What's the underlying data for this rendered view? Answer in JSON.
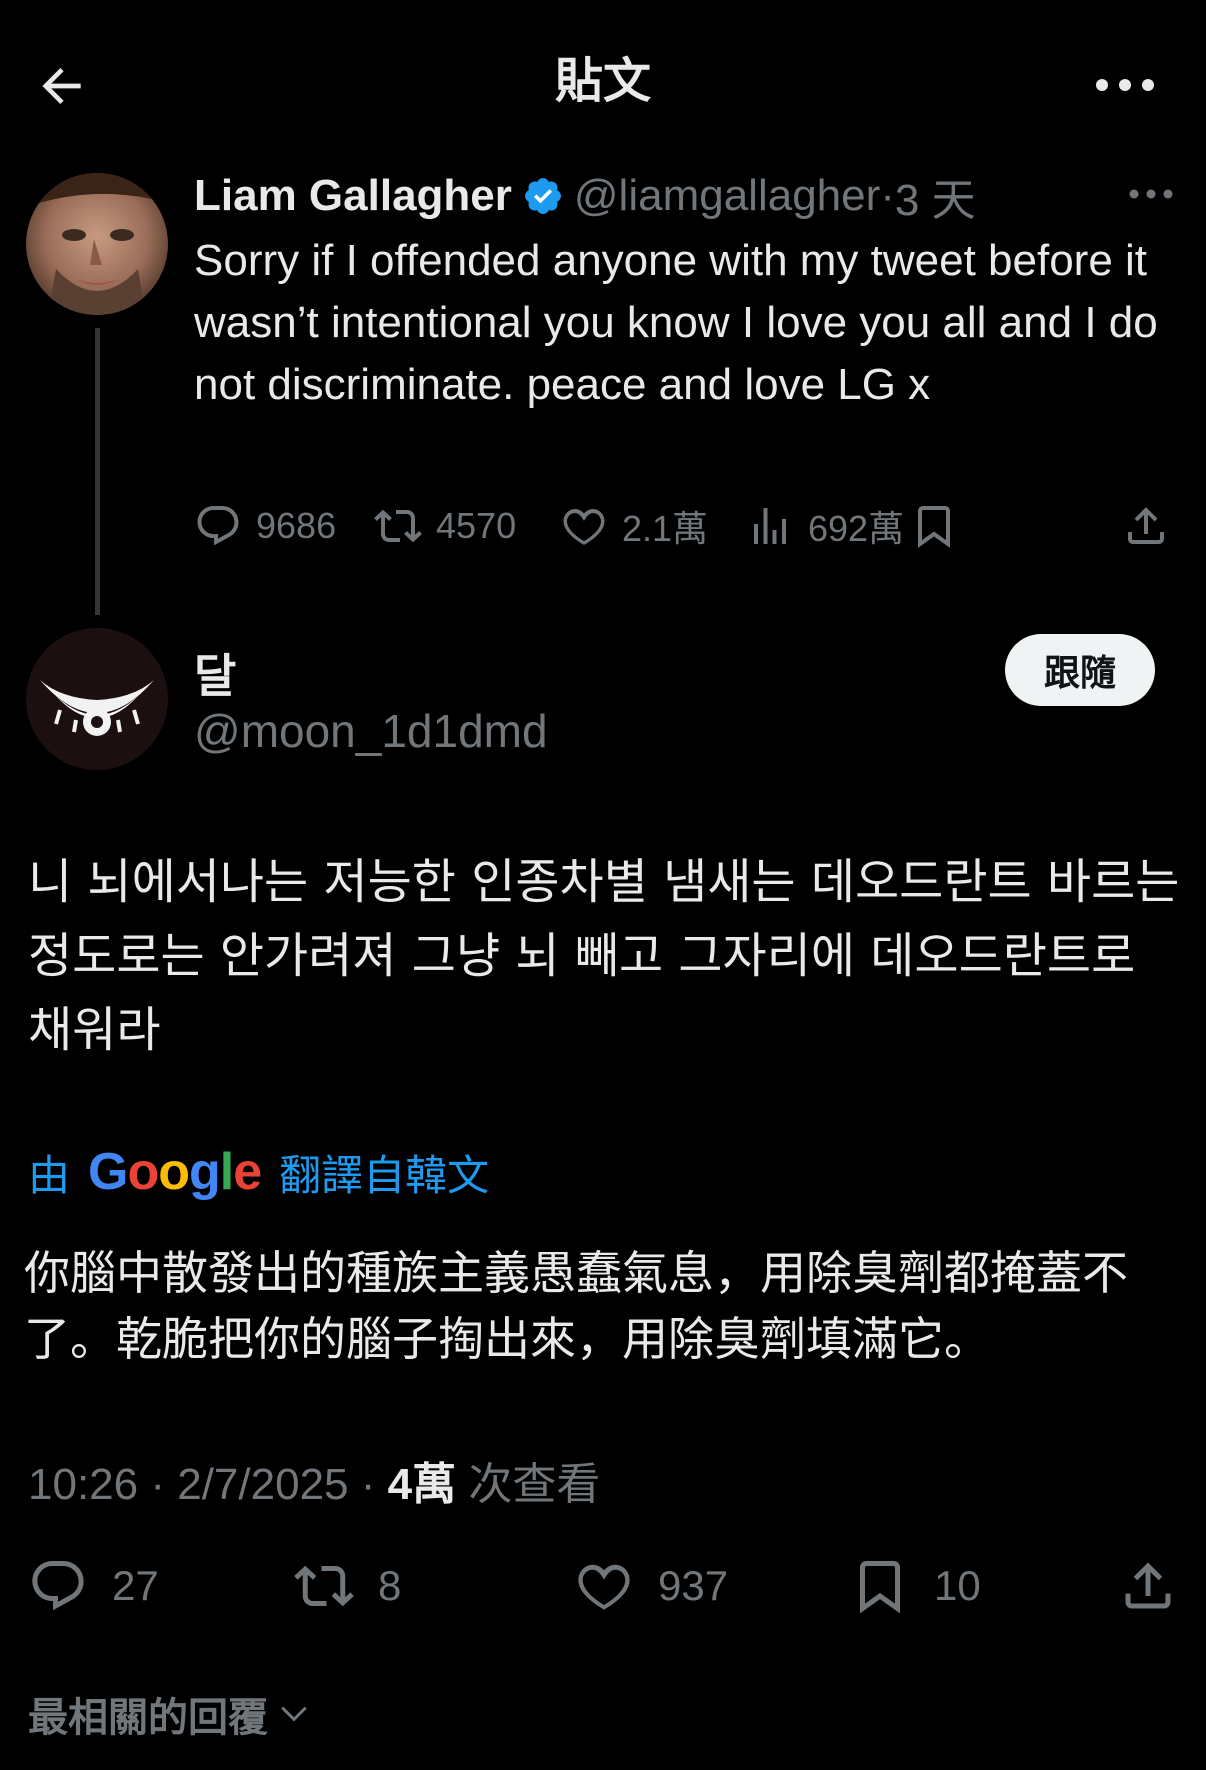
{
  "header": {
    "title": "貼文"
  },
  "parent_tweet": {
    "name": "Liam Gallagher",
    "handle": "@liamgallagher",
    "separator": " · ",
    "time": "3 天",
    "body": "Sorry if I offended anyone with my tweet before it wasn’t intentional you know I love you all and I do not discriminate. peace and love LG x",
    "replies": "9686",
    "reposts": "4570",
    "likes": "2.1萬",
    "views": "692萬"
  },
  "reply": {
    "name": "달",
    "handle": "@moon_1d1dmd",
    "follow_label": "跟隨",
    "body": "니 뇌에서나는 저능한 인종차별 냄새는 데오드란트 바르는 정도로는 안가려져 그냥 뇌 빼고 그자리에 데오드란트로 채워라",
    "translate_prefix": "由",
    "translate_brand": "Google",
    "translate_suffix": "翻譯自韓文",
    "translated_body": "你腦中散發出的種族主義愚蠢氣息，用除臭劑都掩蓋不了。乾脆把你的腦子掏出來，用除臭劑填滿它。",
    "time": "10:26",
    "date": "2/7/2025",
    "views": "4萬",
    "views_label": "次查看",
    "replies": "27",
    "reposts": "8",
    "likes": "937",
    "bookmarks": "10"
  },
  "sort_label": "最相關的回覆",
  "colors": {
    "background": "#000000",
    "text": "#e7e9ea",
    "muted": "#71767b",
    "accent": "#1d9bf0",
    "thread_line": "#333639"
  }
}
